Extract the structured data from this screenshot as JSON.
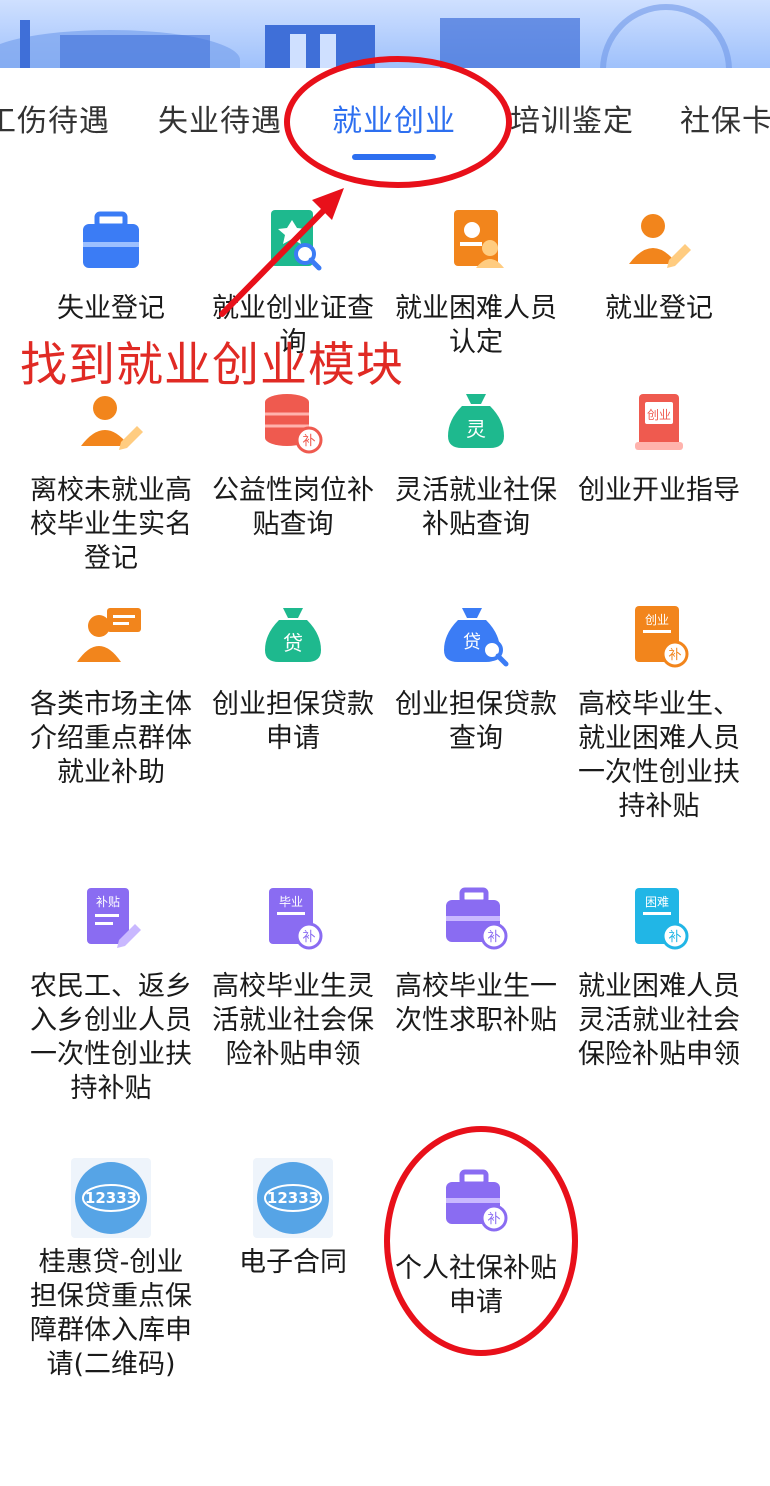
{
  "tabs": [
    {
      "label": "工伤待遇"
    },
    {
      "label": "失业待遇"
    },
    {
      "label": "就业创业"
    },
    {
      "label": "培训鉴定"
    },
    {
      "label": "社保卡"
    }
  ],
  "annotation": {
    "text": "找到就业创业模块"
  },
  "items": [
    {
      "label": "失业登记",
      "icon": "briefcase-icon"
    },
    {
      "label": "就业创业证查询",
      "icon": "certificate-search-icon"
    },
    {
      "label": "就业困难人员认定",
      "icon": "id-card-person-icon"
    },
    {
      "label": "就业登记",
      "icon": "person-pen-icon"
    },
    {
      "label": "离校未就业高校毕业生实名登记",
      "icon": "person-pen-icon"
    },
    {
      "label": "公益性岗位补贴查询",
      "icon": "coin-stack-icon",
      "badge": "补"
    },
    {
      "label": "灵活就业社保补贴查询",
      "icon": "money-bag-icon",
      "badge": "灵"
    },
    {
      "label": "创业开业指导",
      "icon": "book-icon",
      "badge": "创业"
    },
    {
      "label": "各类市场主体介绍重点群体就业补助",
      "icon": "person-message-icon"
    },
    {
      "label": "创业担保贷款申请",
      "icon": "money-bag-icon",
      "badge": "贷"
    },
    {
      "label": "创业担保贷款查询",
      "icon": "money-bag-search-icon",
      "badge": "贷"
    },
    {
      "label": "高校毕业生、就业困难人员一次性创业扶持补贴",
      "icon": "document-subsidy-icon",
      "badge": "创业"
    },
    {
      "label": "农民工、返乡入乡创业人员一次性创业扶持补贴",
      "icon": "document-pen-icon",
      "badge": "补贴"
    },
    {
      "label": "高校毕业生灵活就业社会保险补贴申领",
      "icon": "document-subsidy-icon",
      "badge": "毕业"
    },
    {
      "label": "高校毕业生一次性求职补贴",
      "icon": "briefcase-subsidy-icon"
    },
    {
      "label": "就业困难人员灵活就业社会保险补贴申领",
      "icon": "document-subsidy-icon",
      "badge": "困难"
    },
    {
      "label": "桂惠贷-创业担保贷重点保障群体入库申请(二维码)",
      "icon": "hotline-logo-icon",
      "badge": "12333"
    },
    {
      "label": "电子合同",
      "icon": "hotline-logo-icon",
      "badge": "12333"
    },
    {
      "label": "个人社保补贴申请",
      "icon": "briefcase-subsidy-icon"
    }
  ],
  "colors": {
    "accent": "#2d6ff0",
    "annotation": "#e8101a",
    "blue": "#3b7cf5",
    "orange": "#f2851c",
    "green": "#1eb98e",
    "red": "#ef5a4f",
    "purple": "#8a6cf2",
    "cyan": "#21b6e6"
  }
}
